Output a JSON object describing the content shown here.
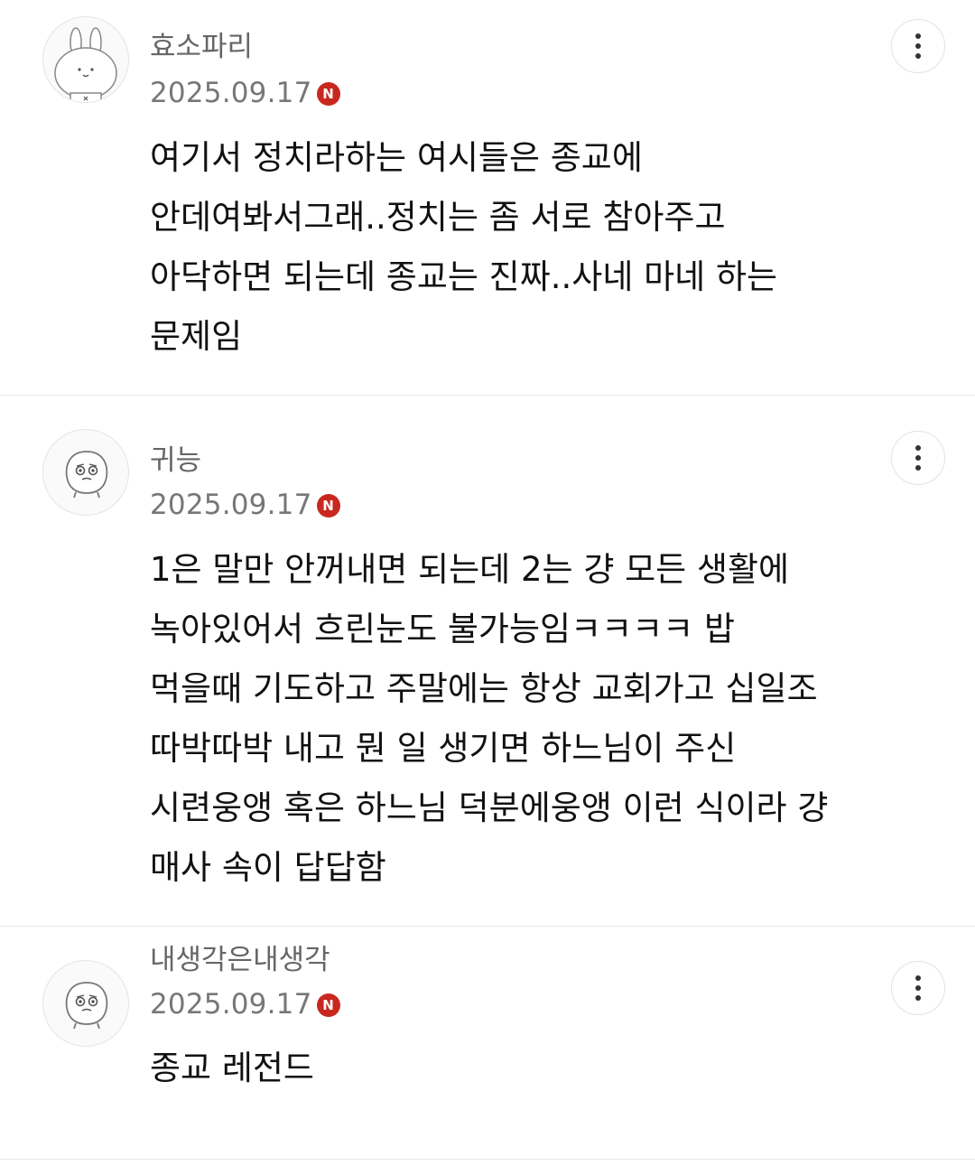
{
  "comments": [
    {
      "author": "효소파리",
      "avatar": "bunny-avatar-icon",
      "date": "2025.09.17",
      "badge": "N",
      "lines": [
        "여기서 정치라하는 여시들은 종교에",
        "안데여봐서그래..정치는 좀 서로 참아주고",
        "아닥하면 되는데 종교는 진짜..사네 마네 하는",
        "문제임"
      ]
    },
    {
      "author": "귀능",
      "avatar": "blob-character-avatar-icon",
      "date": "2025.09.17",
      "badge": "N",
      "lines": [
        "1은 말만 안꺼내면 되는데 2는 걍 모든 생활에",
        "녹아있어서 흐린눈도 불가능임ㅋㅋㅋㅋ 밥",
        "먹을때 기도하고 주말에는 항상 교회가고 십일조",
        "따박따박 내고 뭔 일 생기면 하느님이 주신",
        "시련웅앵 혹은 하느님 덕분에웅앵 이런 식이라 걍",
        "매사 속이 답답함"
      ]
    },
    {
      "author": "내생각은내생각",
      "avatar": "blob-character-avatar-icon",
      "date": "2025.09.17",
      "badge": "N",
      "lines": [
        "종교 레전드"
      ]
    }
  ],
  "colors": {
    "badge": "#c8281e",
    "author": "#666666",
    "date": "#777777",
    "divider": "#e6e6e6"
  }
}
